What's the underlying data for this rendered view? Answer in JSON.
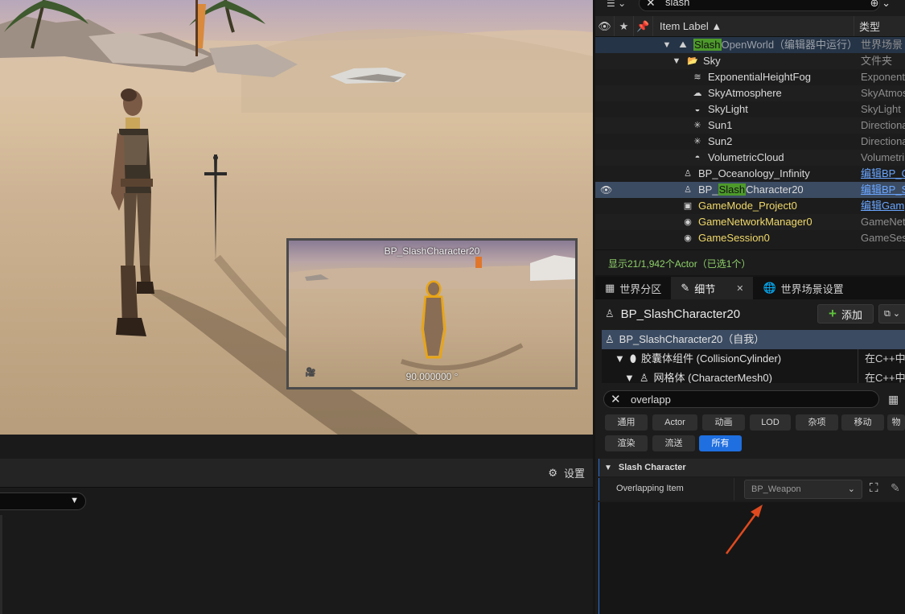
{
  "viewport": {
    "preview": {
      "title": "BP_SlashCharacter20",
      "angle": "90.000000 °"
    }
  },
  "bottom_left": {
    "settings_label": "设置",
    "settings_icon": "gear-icon"
  },
  "outliner": {
    "search_value": "slash",
    "column_label": "Item Label ▲",
    "column_type": "类型",
    "rows": [
      {
        "name_pre": "",
        "name_hl": "Slash",
        "name_post": "OpenWorld（编辑器中运行）",
        "type": "世界场景"
      },
      {
        "name": "Sky",
        "type": "文件夹"
      },
      {
        "name": "ExponentialHeightFog",
        "type": "Exponenti"
      },
      {
        "name": "SkyAtmosphere",
        "type": "SkyAtmos"
      },
      {
        "name": "SkyLight",
        "type": "SkyLight"
      },
      {
        "name": "Sun1",
        "type": "Directiona"
      },
      {
        "name": "Sun2",
        "type": "Directiona"
      },
      {
        "name": "VolumetricCloud",
        "type": "Volumetri"
      },
      {
        "name": "BP_Oceanology_Infinity",
        "type": "编辑BP_O"
      },
      {
        "name_pre": "BP_",
        "name_hl": "Slash",
        "name_post": "Character20",
        "type": "编辑BP_S"
      },
      {
        "name": "GameMode_Project0",
        "type": "编辑Gam"
      },
      {
        "name": "GameNetworkManager0",
        "type": "GameNet"
      },
      {
        "name": "GameSession0",
        "type": "GameSes"
      }
    ],
    "status": "显示21/1,942个Actor（已选1个）"
  },
  "details": {
    "tabs": [
      "世界分区",
      "细节",
      "世界场景设置"
    ],
    "actor_name": "BP_SlashCharacter20",
    "add_label": "添加",
    "components": [
      {
        "label": "BP_SlashCharacter20（自我）",
        "right": ""
      },
      {
        "label": "胶囊体组件 (CollisionCylinder)",
        "right": "在C++中编"
      },
      {
        "label": "网格体 (CharacterMesh0)",
        "right": "在C++中编"
      }
    ],
    "search_value": "overlapp",
    "categories_row1": [
      "通用",
      "Actor",
      "动画",
      "LOD",
      "杂项",
      "移动",
      "物"
    ],
    "categories_row2": [
      "渲染",
      "流送",
      "所有"
    ],
    "section_title": "Slash Character",
    "property_label": "Overlapping Item",
    "property_value": "BP_Weapon",
    "annotation_color": "#e04a1f"
  }
}
